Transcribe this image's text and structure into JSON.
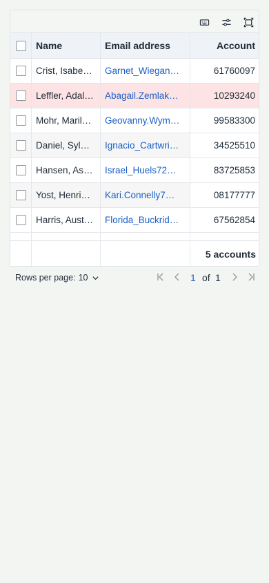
{
  "toolbar": {
    "icons": [
      "keyboard-icon",
      "sliders-icon",
      "fullscreen-icon"
    ]
  },
  "table": {
    "columns": {
      "name": "Name",
      "email": "Email address",
      "account": "Account"
    },
    "rows": [
      {
        "name": "Crist, Isabe…",
        "email": "Garnet_Wiegan…",
        "account": "61760097"
      },
      {
        "name": "Leffler, Adal…",
        "email": "Abagail.Zemlak…",
        "account": "10293240"
      },
      {
        "name": "Mohr, Maril…",
        "email": "Geovanny.Wym…",
        "account": "99583300"
      },
      {
        "name": "Daniel, Syl…",
        "email": "Ignacio_Cartwri…",
        "account": "34525510"
      },
      {
        "name": "Hansen, As…",
        "email": "Israel_Huels72…",
        "account": "83725853"
      },
      {
        "name": "Yost, Henri…",
        "email": "Kari.Connelly7…",
        "account": "08177777"
      },
      {
        "name": "Harris, Aust…",
        "email": "Florida_Buckrid…",
        "account": "67562854"
      }
    ],
    "footer_total": "5 accounts"
  },
  "pagination": {
    "rows_per_page_label": "Rows per page:",
    "rows_per_page_value": "10",
    "current_page": "1",
    "of_label": "of",
    "total_pages": "1"
  },
  "colors": {
    "background": "#f3f5f3",
    "header": "#eff2f7",
    "selected_row": "#fde3e3",
    "link": "#1b5fc7"
  }
}
